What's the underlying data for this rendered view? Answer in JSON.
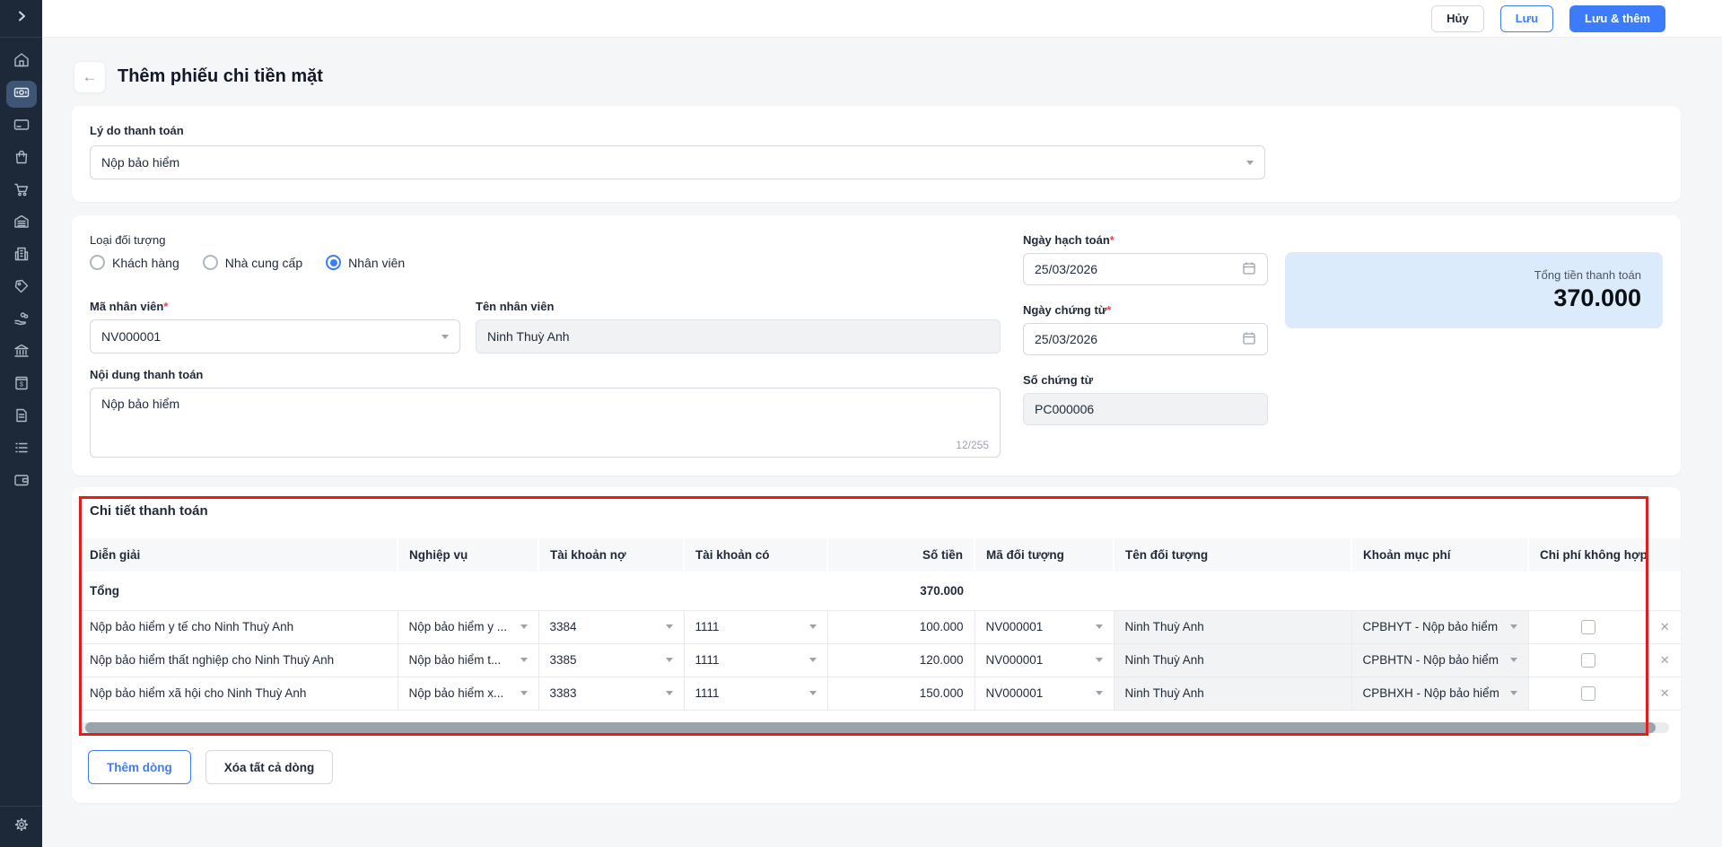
{
  "topbar": {
    "cancel": "Hủy",
    "save": "Lưu",
    "save_and_add": "Lưu & thêm"
  },
  "page": {
    "title": "Thêm phiếu chi tiền mặt"
  },
  "reason": {
    "label": "Lý do thanh toán",
    "value": "Nộp bảo hiểm"
  },
  "form": {
    "object_type": {
      "label": "Loại đối tượng",
      "options": [
        {
          "label": "Khách hàng",
          "selected": false
        },
        {
          "label": "Nhà cung cấp",
          "selected": false
        },
        {
          "label": "Nhân viên",
          "selected": true
        }
      ]
    },
    "employee_code": {
      "label": "Mã nhân viên",
      "value": "NV000001"
    },
    "employee_name": {
      "label": "Tên nhân viên",
      "value": "Ninh Thuỳ Anh"
    },
    "payment_content": {
      "label": "Nội dung thanh toán",
      "value": "Nộp bảo hiểm",
      "counter": "12/255"
    },
    "posting_date": {
      "label": "Ngày hạch toán",
      "value": "25/03/2026"
    },
    "document_date": {
      "label": "Ngày chứng từ",
      "value": "25/03/2026"
    },
    "document_number": {
      "label": "Số chứng từ",
      "value": "PC000006"
    },
    "total": {
      "label": "Tổng tiền thanh toán",
      "value": "370.000"
    }
  },
  "detail": {
    "title": "Chi tiết thanh toán",
    "columns": [
      "Diễn giải",
      "Nghiệp vụ",
      "Tài khoản nợ",
      "Tài khoản có",
      "Số tiền",
      "Mã đối tượng",
      "Tên đối tượng",
      "Khoản mục phí",
      "Chi phí không hợp"
    ],
    "total_label": "Tổng",
    "total_amount": "370.000",
    "rows": [
      {
        "description": "Nộp bảo hiểm y tế cho Ninh Thuỳ Anh",
        "operation": "Nộp bảo hiểm y ...",
        "debit_account": "3384",
        "credit_account": "1111",
        "amount": "100.000",
        "object_code": "NV000001",
        "object_name": "Ninh Thuỳ Anh",
        "expense_item": "CPBHYT - Nộp bảo hiểm"
      },
      {
        "description": "Nộp bảo hiểm thất nghiệp cho Ninh Thuỳ Anh",
        "operation": "Nộp bảo hiểm t...",
        "debit_account": "3385",
        "credit_account": "1111",
        "amount": "120.000",
        "object_code": "NV000001",
        "object_name": "Ninh Thuỳ Anh",
        "expense_item": "CPBHTN - Nộp bảo hiểm"
      },
      {
        "description": "Nộp bảo hiểm xã hội cho Ninh Thuỳ Anh",
        "operation": "Nộp bảo hiểm x...",
        "debit_account": "3383",
        "credit_account": "1111",
        "amount": "150.000",
        "object_code": "NV000001",
        "object_name": "Ninh Thuỳ Anh",
        "expense_item": "CPBHXH - Nộp bảo hiểm"
      }
    ],
    "add_row": "Thêm dòng",
    "delete_all": "Xóa tất cả dòng"
  },
  "sidebar": {
    "icons": [
      "chevron-right",
      "home",
      "cash",
      "credit-card",
      "shopping-bag",
      "shopping-cart",
      "warehouse",
      "building",
      "tag",
      "hand-coins",
      "bank",
      "cash-book",
      "document",
      "list",
      "wallet",
      "settings"
    ]
  },
  "colors": {
    "accent": "#3c7cfa",
    "highlight_red": "#e01e1e",
    "total_box_bg": "#dcebfb",
    "sidebar_bg": "#1d2939"
  }
}
